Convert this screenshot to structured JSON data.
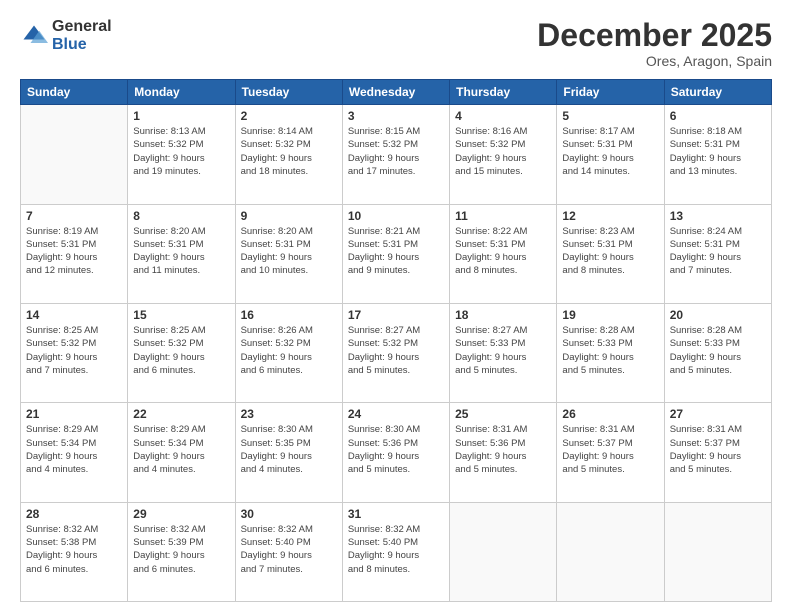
{
  "logo": {
    "general": "General",
    "blue": "Blue"
  },
  "title": "December 2025",
  "location": "Ores, Aragon, Spain",
  "days_header": [
    "Sunday",
    "Monday",
    "Tuesday",
    "Wednesday",
    "Thursday",
    "Friday",
    "Saturday"
  ],
  "weeks": [
    [
      {
        "day": "",
        "info": ""
      },
      {
        "day": "1",
        "info": "Sunrise: 8:13 AM\nSunset: 5:32 PM\nDaylight: 9 hours\nand 19 minutes."
      },
      {
        "day": "2",
        "info": "Sunrise: 8:14 AM\nSunset: 5:32 PM\nDaylight: 9 hours\nand 18 minutes."
      },
      {
        "day": "3",
        "info": "Sunrise: 8:15 AM\nSunset: 5:32 PM\nDaylight: 9 hours\nand 17 minutes."
      },
      {
        "day": "4",
        "info": "Sunrise: 8:16 AM\nSunset: 5:32 PM\nDaylight: 9 hours\nand 15 minutes."
      },
      {
        "day": "5",
        "info": "Sunrise: 8:17 AM\nSunset: 5:31 PM\nDaylight: 9 hours\nand 14 minutes."
      },
      {
        "day": "6",
        "info": "Sunrise: 8:18 AM\nSunset: 5:31 PM\nDaylight: 9 hours\nand 13 minutes."
      }
    ],
    [
      {
        "day": "7",
        "info": "Sunrise: 8:19 AM\nSunset: 5:31 PM\nDaylight: 9 hours\nand 12 minutes."
      },
      {
        "day": "8",
        "info": "Sunrise: 8:20 AM\nSunset: 5:31 PM\nDaylight: 9 hours\nand 11 minutes."
      },
      {
        "day": "9",
        "info": "Sunrise: 8:20 AM\nSunset: 5:31 PM\nDaylight: 9 hours\nand 10 minutes."
      },
      {
        "day": "10",
        "info": "Sunrise: 8:21 AM\nSunset: 5:31 PM\nDaylight: 9 hours\nand 9 minutes."
      },
      {
        "day": "11",
        "info": "Sunrise: 8:22 AM\nSunset: 5:31 PM\nDaylight: 9 hours\nand 8 minutes."
      },
      {
        "day": "12",
        "info": "Sunrise: 8:23 AM\nSunset: 5:31 PM\nDaylight: 9 hours\nand 8 minutes."
      },
      {
        "day": "13",
        "info": "Sunrise: 8:24 AM\nSunset: 5:31 PM\nDaylight: 9 hours\nand 7 minutes."
      }
    ],
    [
      {
        "day": "14",
        "info": "Sunrise: 8:25 AM\nSunset: 5:32 PM\nDaylight: 9 hours\nand 7 minutes."
      },
      {
        "day": "15",
        "info": "Sunrise: 8:25 AM\nSunset: 5:32 PM\nDaylight: 9 hours\nand 6 minutes."
      },
      {
        "day": "16",
        "info": "Sunrise: 8:26 AM\nSunset: 5:32 PM\nDaylight: 9 hours\nand 6 minutes."
      },
      {
        "day": "17",
        "info": "Sunrise: 8:27 AM\nSunset: 5:32 PM\nDaylight: 9 hours\nand 5 minutes."
      },
      {
        "day": "18",
        "info": "Sunrise: 8:27 AM\nSunset: 5:33 PM\nDaylight: 9 hours\nand 5 minutes."
      },
      {
        "day": "19",
        "info": "Sunrise: 8:28 AM\nSunset: 5:33 PM\nDaylight: 9 hours\nand 5 minutes."
      },
      {
        "day": "20",
        "info": "Sunrise: 8:28 AM\nSunset: 5:33 PM\nDaylight: 9 hours\nand 5 minutes."
      }
    ],
    [
      {
        "day": "21",
        "info": "Sunrise: 8:29 AM\nSunset: 5:34 PM\nDaylight: 9 hours\nand 4 minutes."
      },
      {
        "day": "22",
        "info": "Sunrise: 8:29 AM\nSunset: 5:34 PM\nDaylight: 9 hours\nand 4 minutes."
      },
      {
        "day": "23",
        "info": "Sunrise: 8:30 AM\nSunset: 5:35 PM\nDaylight: 9 hours\nand 4 minutes."
      },
      {
        "day": "24",
        "info": "Sunrise: 8:30 AM\nSunset: 5:36 PM\nDaylight: 9 hours\nand 5 minutes."
      },
      {
        "day": "25",
        "info": "Sunrise: 8:31 AM\nSunset: 5:36 PM\nDaylight: 9 hours\nand 5 minutes."
      },
      {
        "day": "26",
        "info": "Sunrise: 8:31 AM\nSunset: 5:37 PM\nDaylight: 9 hours\nand 5 minutes."
      },
      {
        "day": "27",
        "info": "Sunrise: 8:31 AM\nSunset: 5:37 PM\nDaylight: 9 hours\nand 5 minutes."
      }
    ],
    [
      {
        "day": "28",
        "info": "Sunrise: 8:32 AM\nSunset: 5:38 PM\nDaylight: 9 hours\nand 6 minutes."
      },
      {
        "day": "29",
        "info": "Sunrise: 8:32 AM\nSunset: 5:39 PM\nDaylight: 9 hours\nand 6 minutes."
      },
      {
        "day": "30",
        "info": "Sunrise: 8:32 AM\nSunset: 5:40 PM\nDaylight: 9 hours\nand 7 minutes."
      },
      {
        "day": "31",
        "info": "Sunrise: 8:32 AM\nSunset: 5:40 PM\nDaylight: 9 hours\nand 8 minutes."
      },
      {
        "day": "",
        "info": ""
      },
      {
        "day": "",
        "info": ""
      },
      {
        "day": "",
        "info": ""
      }
    ]
  ]
}
